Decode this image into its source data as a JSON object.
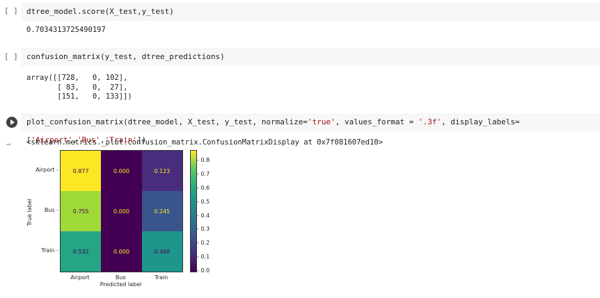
{
  "cells": [
    {
      "run_label": "[ ]",
      "code": "dtree_model.score(X_test,y_test)",
      "output": [
        "0.7034313725490197"
      ]
    },
    {
      "run_label": "[ ]",
      "code": "confusion_matrix(y_test, dtree_predictions)",
      "output": [
        "array([[728,   0, 102],",
        "       [ 83,   0,  27],",
        "       [151,   0, 133]])"
      ]
    },
    {
      "code_pre": "plot_confusion_matrix(dtree_model, X_test, y_test, normalize=",
      "s1": "'true'",
      "code_mid": ", values_format = ",
      "s2": "'.3f'",
      "code_mid2": ", display_labels=[",
      "s3": "'Airport'",
      "c1": ",",
      "s4": "'Bus'",
      "c2": ",",
      "s5": "'Train'",
      "code_end": "])",
      "output": [
        "<sklearn.metrics._plot.confusion_matrix.ConfusionMatrixDisplay at 0x7f081607ed10>"
      ]
    }
  ],
  "chart_data": {
    "type": "heatmap",
    "xlabel": "Predicted label",
    "ylabel": "True label",
    "x_labels": [
      "Airport",
      "Bus",
      "Train"
    ],
    "y_labels": [
      "Airport",
      "Bus",
      "Train"
    ],
    "values": [
      [
        0.877,
        0.0,
        0.123
      ],
      [
        0.755,
        0.0,
        0.245
      ],
      [
        0.532,
        0.0,
        0.468
      ]
    ],
    "colors": [
      [
        "#fde725",
        "#440154",
        "#472d7b"
      ],
      [
        "#a0da39",
        "#440154",
        "#39558c"
      ],
      [
        "#25a584",
        "#440154",
        "#1f968b"
      ]
    ],
    "text_colors": [
      [
        "#440154",
        "#fde725",
        "#fde725"
      ],
      [
        "#440154",
        "#fde725",
        "#fde725"
      ],
      [
        "#440154",
        "#fde725",
        "#440154"
      ]
    ],
    "colorbar_ticks": [
      "0.0",
      "0.1",
      "0.2",
      "0.3",
      "0.4",
      "0.5",
      "0.6",
      "0.7",
      "0.8"
    ],
    "colorbar_range": [
      0,
      0.877
    ]
  }
}
